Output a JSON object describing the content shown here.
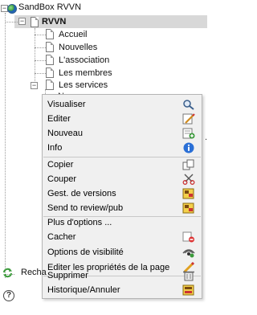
{
  "tree": {
    "root_label": "SandBox RVVN",
    "site_label": "RVVN",
    "pages": [
      {
        "label": "Accueil"
      },
      {
        "label": "Nouvelles"
      },
      {
        "label": "L'association"
      },
      {
        "label": "Les membres"
      },
      {
        "label": "Les services"
      }
    ],
    "partial_child_label": "Nos contrats"
  },
  "context_menu": {
    "items": [
      {
        "label": "Visualiser",
        "icon": "magnifier-icon"
      },
      {
        "label": "Editer",
        "icon": "pencil-edit-icon"
      },
      {
        "label": "Nouveau",
        "icon": "new-page-icon"
      },
      {
        "label": "Info",
        "icon": "info-icon"
      },
      {
        "label": "Copier",
        "icon": "copy-icon"
      },
      {
        "label": "Couper",
        "icon": "scissors-icon"
      },
      {
        "label": "Gest. de versions",
        "icon": "versions-icon"
      },
      {
        "label": "Send to review/pub",
        "icon": "review-icon"
      },
      {
        "label": "Plus d'options ...",
        "icon": ""
      },
      {
        "label": "Cacher",
        "icon": "hide-icon"
      },
      {
        "label": "Options de visibilité",
        "icon": "visibility-icon"
      },
      {
        "label": "Editer les propriétés de la page",
        "icon": "pencil-icon"
      },
      {
        "label": "Supprimer",
        "icon": "trash-icon"
      },
      {
        "label": "Historique/Annuler",
        "icon": "history-icon"
      }
    ]
  },
  "bottom": {
    "refresh_label": "Recha",
    "help_symbol": "?"
  },
  "colors": {
    "selected_row": "#d8d8d8",
    "menu_bg": "#f0f0f0",
    "info_blue": "#2a6fd6",
    "refresh_green": "#3a9a3a"
  }
}
